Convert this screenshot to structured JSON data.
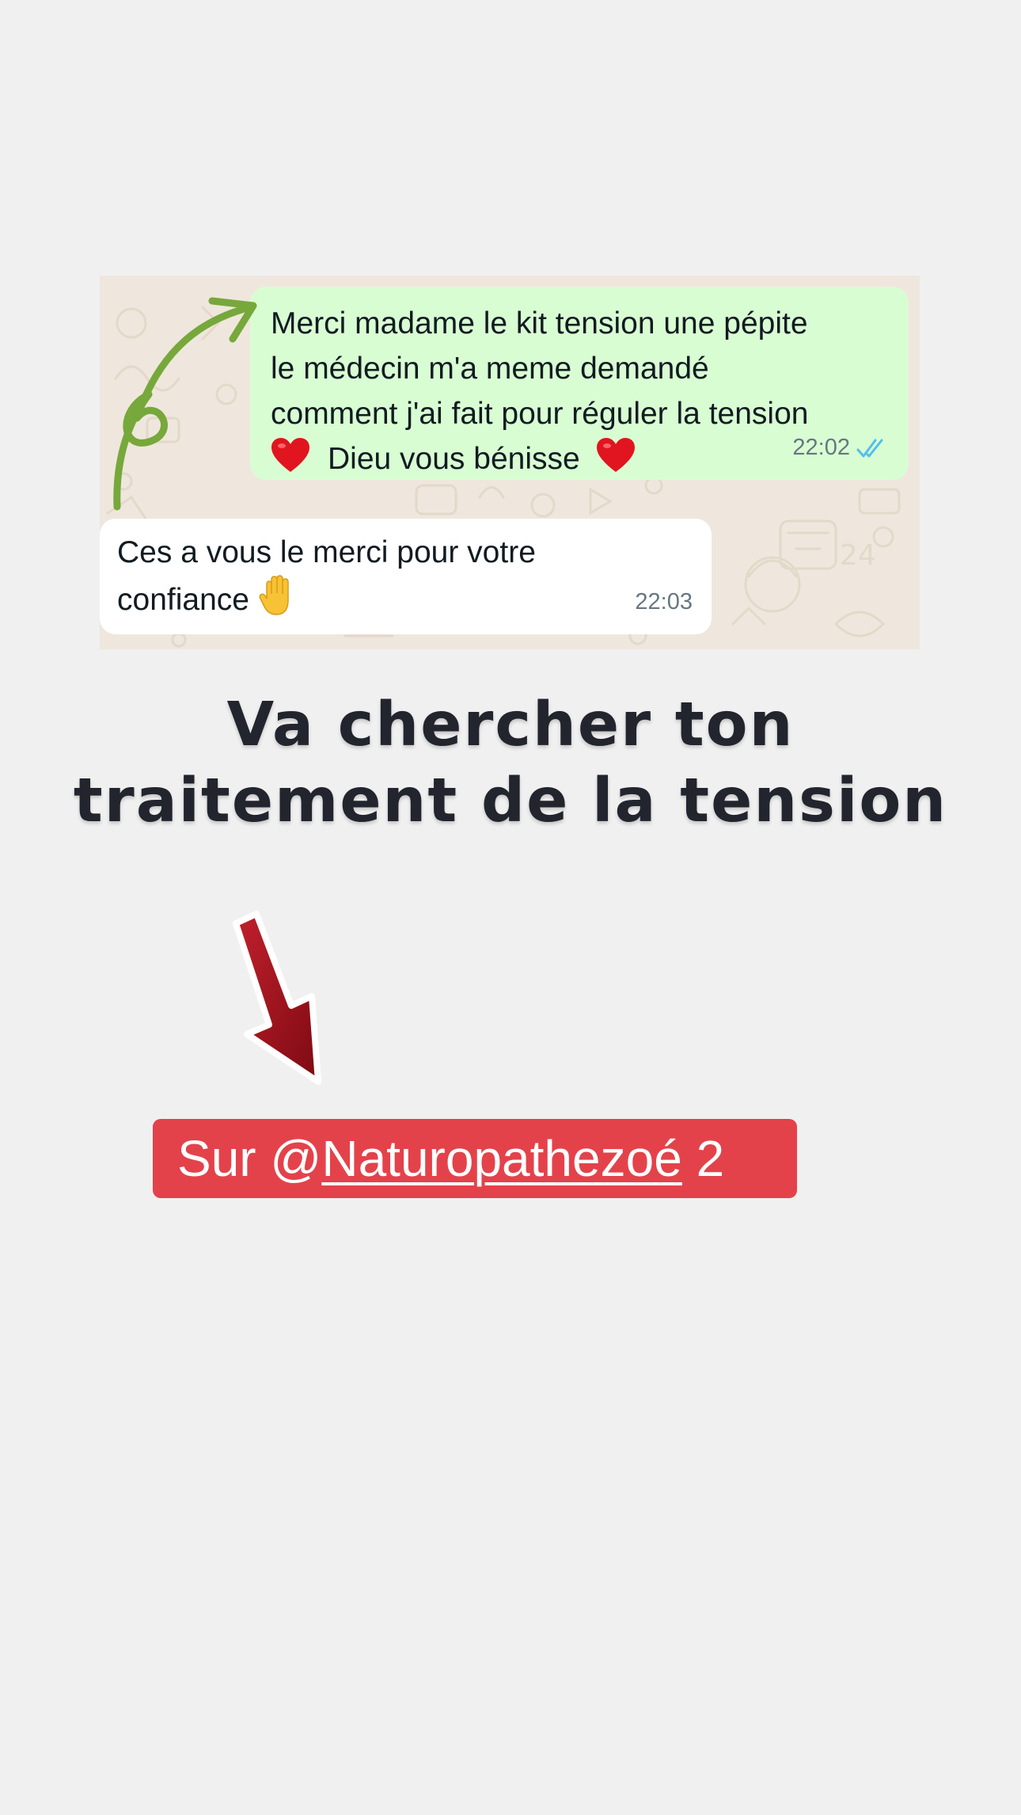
{
  "chat": {
    "outgoing_message": {
      "lines": [
        "Merci madame le kit tension une pépite",
        "le médecin m'a meme demandé",
        "comment j'ai fait pour réguler la tension"
      ],
      "last_line_text": "Dieu vous bénisse",
      "time": "22:02",
      "status": "read",
      "icons": [
        "heart-icon",
        "heart-icon",
        "double-check-icon"
      ]
    },
    "incoming_message": {
      "lines": [
        "Ces a vous le merci pour votre"
      ],
      "last_line_text": "confiance",
      "time": "22:03",
      "icons": [
        "raised-hand-icon"
      ]
    }
  },
  "headline": {
    "line1": "Va chercher ton",
    "line2": "traitement de la tension"
  },
  "mention": {
    "prefix": "Sur @",
    "handle": "Naturopathezoé",
    "suffix": " 2"
  },
  "colors": {
    "background": "#f0f0f1",
    "outgoing_bubble": "#d9fdd3",
    "incoming_bubble": "#ffffff",
    "green_arrow": "#77a83b",
    "red_arrow": "#9a0f19",
    "mention_tag": "#e4424a",
    "headline_text": "#22252d",
    "read_ticks": "#53bdeb"
  }
}
